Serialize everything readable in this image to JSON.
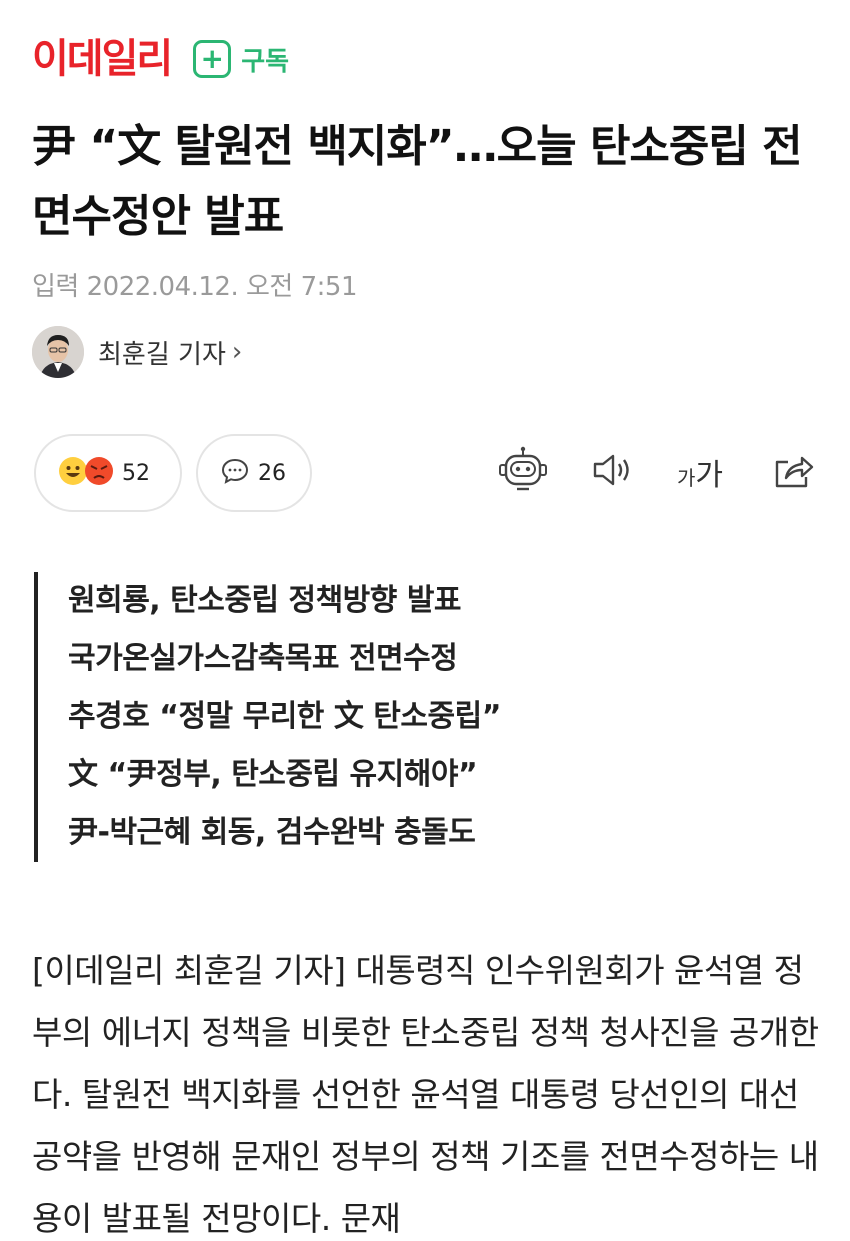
{
  "header": {
    "logo_text": "이데일리",
    "subscribe_label": "구독",
    "subscribe_icon": "plus-icon",
    "accent_red": "#e8232a",
    "accent_green": "#2bb673"
  },
  "article": {
    "headline": "尹 “文 탈원전 백지화”…오늘 탄소중립 전면수정안 발표",
    "timestamp": "입력 2022.04.12. 오전 7:51",
    "author": "최훈길 기자",
    "author_chevron": "›"
  },
  "actions": {
    "reactions_count": "52",
    "comments_count": "26",
    "font_small": "가",
    "font_big": "가",
    "icons": [
      "emoji-smile-icon",
      "emoji-angry-icon",
      "comment-icon",
      "robot-icon",
      "speaker-icon",
      "font-size-icon",
      "share-icon"
    ]
  },
  "summary": [
    "원희룡, 탄소중립 정책방향 발표",
    "국가온실가스감축목표 전면수정",
    "추경호 “정말 무리한 文 탄소중립”",
    "文 “尹정부, 탄소중립 유지해야”",
    "尹-박근혜 회동, 검수완박 충돌도"
  ],
  "body": "[이데일리 최훈길 기자] 대통령직 인수위원회가 윤석열 정부의 에너지 정책을 비롯한 탄소중립 정책 청사진을 공개한다. 탈원전 백지화를 선언한 윤석열 대통령 당선인의 대선 공약을 반영해 문재인 정부의 정책 기조를 전면수정하는 내용이 발표될 전망이다. 문재"
}
